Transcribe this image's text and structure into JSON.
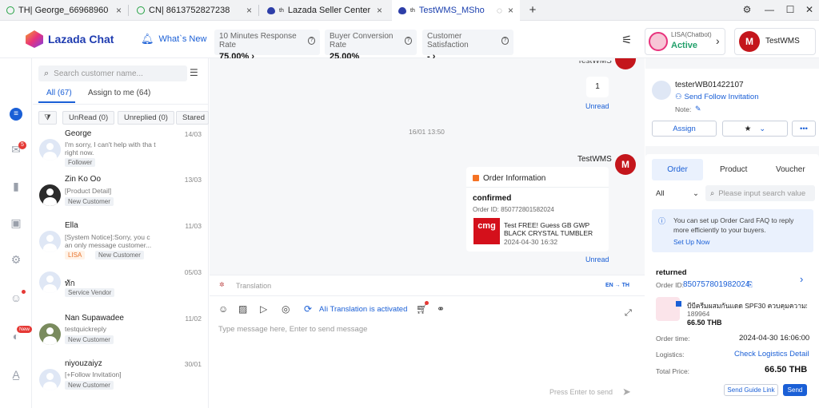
{
  "tabs": [
    {
      "label": "TH| George_66968960",
      "icon": "whatsapp-icon"
    },
    {
      "label": "CN| 8613752827238",
      "icon": "whatsapp-icon"
    },
    {
      "label": "Lazada Seller Center",
      "prefix": "th",
      "icon": "lazada-icon"
    },
    {
      "label": "TestWMS_MSho",
      "prefix": "th",
      "icon": "lazada-icon"
    }
  ],
  "header": {
    "app_name": "Lazada Chat",
    "whats_new": "What`s New",
    "metrics": [
      {
        "title": "10 Minutes Response Rate",
        "value": "75.00%"
      },
      {
        "title": "Buyer Conversion Rate",
        "value": "25.00%"
      },
      {
        "title": "Customer Satisfaction",
        "value": "-"
      }
    ],
    "lisa": {
      "name": "LISA(Chatbot)",
      "status": "Active",
      "badge_color": "#22a06b"
    },
    "shop": {
      "name": "TestWMS"
    }
  },
  "rail": {
    "mail_badge": "5",
    "new_badge": "New"
  },
  "list": {
    "search_placeholder": "Search customer name...",
    "tabs": [
      "All (67)",
      "Assign to me (64)"
    ],
    "filters": [
      "UnRead (0)",
      "Unreplied (0)",
      "Stared"
    ],
    "conversations": [
      {
        "name": "George",
        "date": "14/03",
        "msg": "I'm sorry, I can't help with tha t right now.",
        "tags": [
          "Follower"
        ]
      },
      {
        "name": "Zin Ko Oo",
        "date": "13/03",
        "msg": "[Product Detail]",
        "tags": [
          "New Customer"
        ]
      },
      {
        "name": "Ella",
        "date": "11/03",
        "msg": "[System Notice]:Sorry, you c an only message customer...",
        "tags": [
          "LISA",
          "New Customer"
        ]
      },
      {
        "name": "ทัก",
        "date": "05/03",
        "msg": "",
        "tags": [
          "Service Vendor"
        ]
      },
      {
        "name": "Nan Supawadee",
        "date": "11/02",
        "msg": "testquickreply",
        "tags": [
          "New Customer"
        ]
      },
      {
        "name": "niyouzaiyz",
        "date": "30/01",
        "msg": "[+Follow Invitation]",
        "tags": [
          "New Customer"
        ]
      }
    ]
  },
  "chat": {
    "top_sender": "TestWMS",
    "top_bubble": "1",
    "unread1": "Unread",
    "timestamp": "16/01 13:50",
    "sender": "TestWMS",
    "order_card": {
      "title": "Order Information",
      "status": "confirmed",
      "order_id": "Order ID: 850772801582024",
      "product": "Test FREE! Guess GB GWP BLACK CRYSTAL TUMBLER",
      "date": "2024-04-30 16:32",
      "thumb_text": "cmg"
    },
    "unread2": "Unread",
    "translation_label": "Translation",
    "lang": "EN → TH",
    "ai_translation": "AIi Translation is activated",
    "input_placeholder": "Type message here, Enter to send message",
    "send_hint": "Press Enter to send"
  },
  "right": {
    "customer": "testerWB01422107",
    "follow": "Send Follow Invitation",
    "note": "Note:",
    "assign": "Assign",
    "tabs": [
      "Order",
      "Product",
      "Voucher"
    ],
    "filter_all": "All",
    "search_placeholder": "Please input search value",
    "faq_text": "You can set up Order Card FAQ to reply more efficiently to your buyers.",
    "faq_link": "Set Up Now",
    "order_status": "returned",
    "order_id_label": "Order ID:",
    "order_id": "850757801982024",
    "product": "บีบีครีมผสมกันแดด SPF30 ควบคุมความมั*1",
    "sku": "189964",
    "price": "66.50 THB",
    "order_time_label": "Order time:",
    "order_time": "2024-04-30 16:06:00",
    "logistics_label": "Logistics:",
    "logistics": "Check Logistics Detail",
    "total_label": "Total Price:",
    "total": "66.50 THB",
    "send_guide": "Send Guide Link",
    "send": "Send"
  }
}
